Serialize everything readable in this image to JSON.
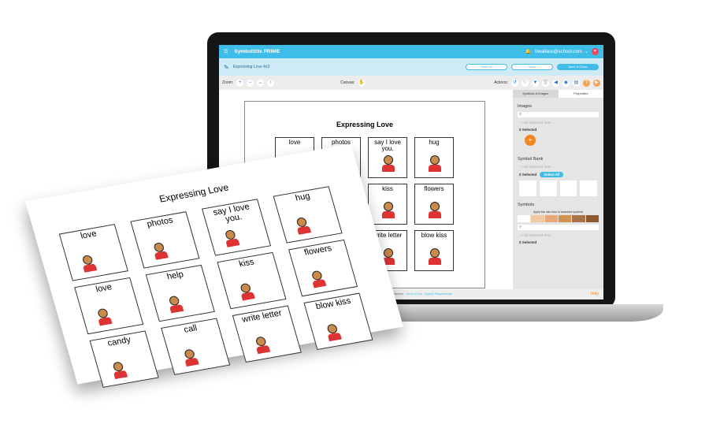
{
  "app": {
    "brand": "SymbolStix PRIME",
    "user": "bwallace@school.com",
    "doc_title": "Expressing Love 4x3",
    "buttons": {
      "save_as": "Save As",
      "save": "Save",
      "save_close": "Save & Close"
    },
    "toolbar": {
      "zoom": "Zoom:",
      "canvas": "Canvas:",
      "actions": "Actions:"
    },
    "board": {
      "title": "Expressing Love",
      "cells": [
        "love",
        "photos",
        "say I love you.",
        "hug",
        "",
        "help",
        "kiss",
        "flowers",
        "",
        "call",
        "write letter",
        "blow kiss"
      ]
    },
    "panel": {
      "tabs": [
        "Symbols & Images",
        "Properties"
      ],
      "images": "Images",
      "add_selected": "+ Add Selected Item",
      "selected": "0 Selected",
      "plus": "+",
      "symbol_bank": "Symbol Bank",
      "select_all": "Select All",
      "symbols": "Symbols",
      "skin_tone": "Apply this skin tone to searched symbols",
      "skin_tones": [
        "#ffffff",
        "#f0c9a0",
        "#e8a878",
        "#d3934f",
        "#a8724a",
        "#8a5a30"
      ]
    },
    "footer": {
      "copyright": "ght © 2021, n2y All rights reserved. -",
      "terms": "Terms of Use",
      "sep": " - ",
      "sysreq": "System Requirements",
      "help": "Help"
    }
  },
  "paper": {
    "title": "Expressing Love",
    "cells": [
      "love",
      "photos",
      "say I love you.",
      "hug",
      "love",
      "help",
      "kiss",
      "flowers",
      "candy",
      "call",
      "write letter",
      "blow kiss"
    ]
  },
  "colors": {
    "accent": "#3fbde9",
    "orange": "#f5851f"
  }
}
